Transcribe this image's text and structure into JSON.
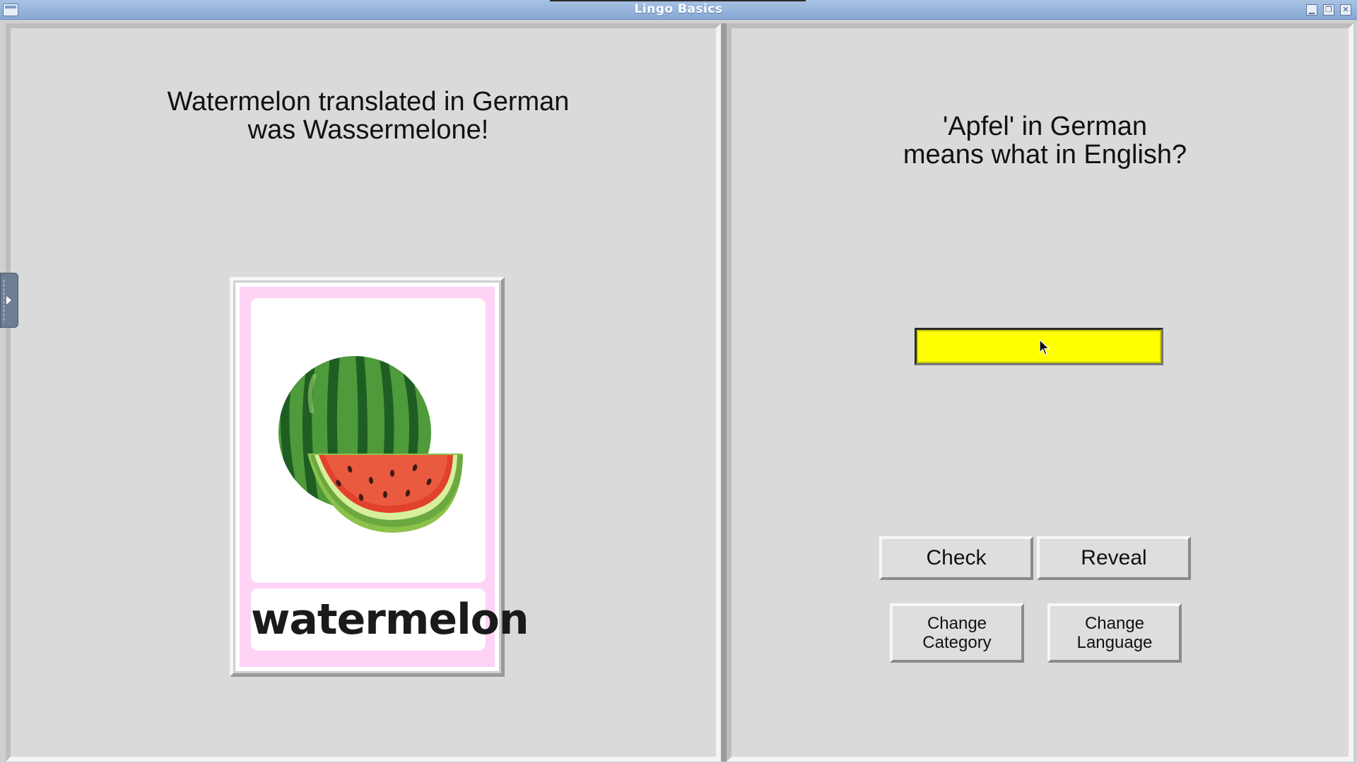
{
  "window": {
    "title": "Lingo Basics"
  },
  "left_panel": {
    "message_line1": "Watermelon translated in German",
    "message_line2": "was Wassermelone!",
    "card": {
      "word": "watermelon",
      "image": "watermelon-illustration"
    }
  },
  "right_panel": {
    "question_line1": "'Apfel' in German",
    "question_line2": "means what in English?",
    "answer": {
      "value": "",
      "placeholder": ""
    },
    "buttons": {
      "check": "Check",
      "reveal": "Reveal",
      "change_category": "Change\nCategory",
      "change_language": "Change\nLanguage"
    }
  },
  "colors": {
    "answer_background": "#ffff00",
    "card_border": "#ffd3f5",
    "titlebar": "#86a7d3"
  },
  "icons": {
    "window_menu": "window-menu-icon",
    "minimize": "minimize-icon",
    "maximize": "maximize-icon",
    "close": "close-icon",
    "side_handle": "expand-arrow-icon"
  }
}
